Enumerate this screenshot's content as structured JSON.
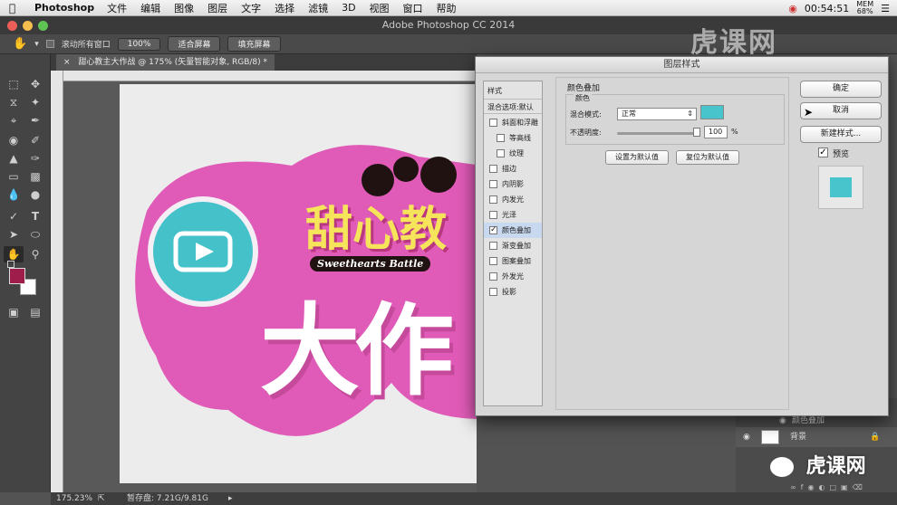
{
  "menubar": {
    "app_name": "Photoshop",
    "items": [
      "文件",
      "编辑",
      "图像",
      "图层",
      "文字",
      "选择",
      "滤镜",
      "3D",
      "视图",
      "窗口",
      "帮助"
    ],
    "clock": "00:54:51",
    "battery_top": "MEM",
    "battery_bottom": "68%"
  },
  "titlebar": {
    "title": "Adobe Photoshop CC 2014"
  },
  "options_bar": {
    "scroll_all_windows": "滚动所有窗口",
    "zoom_100": "100%",
    "fit_screen": "适合屏幕",
    "fill_screen": "填充屏幕"
  },
  "document": {
    "tab_title": "甜心教主大作战 @ 175% (矢量智能对象, RGB/8) *",
    "logo_title": "甜心教",
    "logo_subtitle": "Sweethearts Battle",
    "logo_big": "大作"
  },
  "statusbar": {
    "zoom": "175.23%",
    "scratch": "暂存盘: 7.21G/9.81G"
  },
  "dialog": {
    "title": "图层样式",
    "styles_header": "样式",
    "blend_default": "混合选项:默认",
    "style_items": [
      {
        "label": "斜面和浮雕",
        "checked": false
      },
      {
        "label": "等高线",
        "checked": false
      },
      {
        "label": "纹理",
        "checked": false
      },
      {
        "label": "描边",
        "checked": false
      },
      {
        "label": "内阴影",
        "checked": false
      },
      {
        "label": "内发光",
        "checked": false
      },
      {
        "label": "光泽",
        "checked": false
      },
      {
        "label": "颜色叠加",
        "checked": true
      },
      {
        "label": "渐变叠加",
        "checked": false
      },
      {
        "label": "图案叠加",
        "checked": false
      },
      {
        "label": "外发光",
        "checked": false
      },
      {
        "label": "投影",
        "checked": false
      }
    ],
    "section_title": "颜色叠加",
    "group_title": "颜色",
    "blend_mode_label": "混合模式:",
    "blend_mode_value": "正常",
    "opacity_label": "不透明度:",
    "opacity_value": "100",
    "opacity_unit": "%",
    "overlay_color": "#47c4cc",
    "set_default": "设置为默认值",
    "reset_default": "复位为默认值",
    "ok": "确定",
    "cancel": "取消",
    "new_style": "新建样式...",
    "preview_label": "预览"
  },
  "layers": {
    "effect_label": "颜色叠加",
    "background_label": "背景"
  },
  "watermarks": {
    "top": "虎课网",
    "bottom": "虎课网"
  },
  "colors": {
    "foreground": "#9e1d4a",
    "background": "#ffffff",
    "logo_pink": "#e05bb7",
    "logo_yellow": "#f6e45a",
    "logo_teal": "#45c1c9"
  }
}
